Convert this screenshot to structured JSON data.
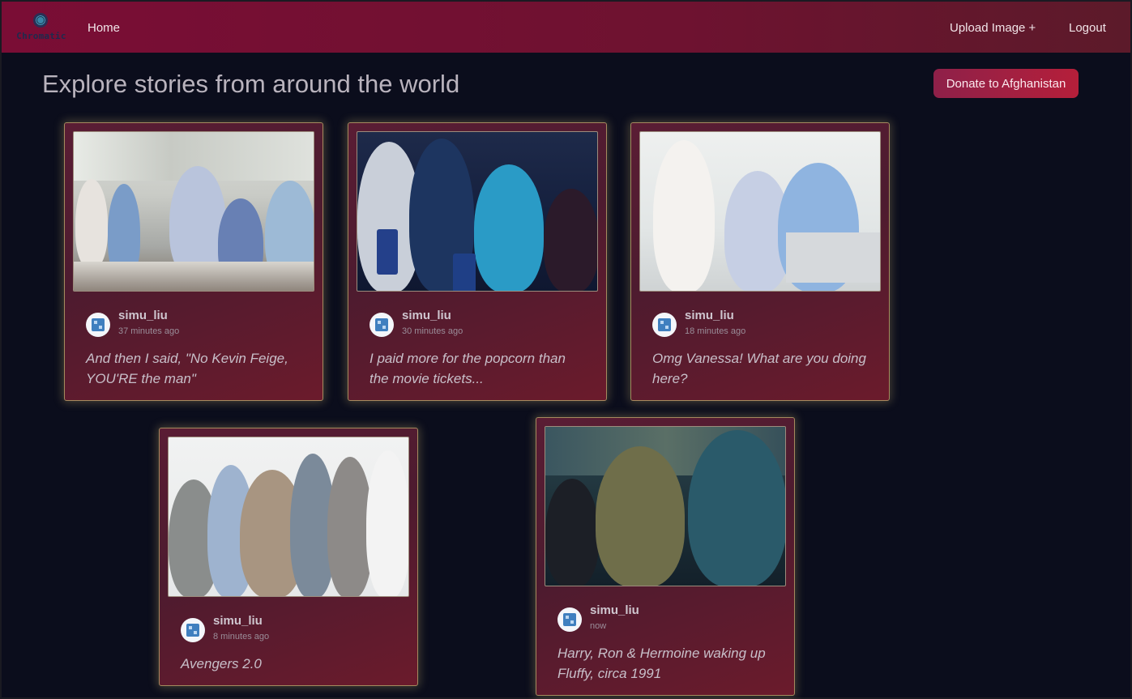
{
  "navbar": {
    "logo_text": "Chromatic",
    "home": "Home",
    "upload": "Upload Image +",
    "logout": "Logout"
  },
  "page": {
    "title": "Explore stories from around the world",
    "donate_label": "Donate to Afghanistan"
  },
  "posts": [
    {
      "username": "simu_liu",
      "time": "37 minutes ago",
      "caption": "And then I said, \"No Kevin Feige, YOU'RE the man\""
    },
    {
      "username": "simu_liu",
      "time": "30 minutes ago",
      "caption": "I paid more for the popcorn than the movie tickets..."
    },
    {
      "username": "simu_liu",
      "time": "18 minutes ago",
      "caption": "Omg Vanessa! What are you doing here?"
    },
    {
      "username": "simu_liu",
      "time": "8 minutes ago",
      "caption": "Avengers 2.0"
    },
    {
      "username": "simu_liu",
      "time": "now",
      "caption": "Harry, Ron & Hermoine waking up Fluffy, circa 1991"
    }
  ],
  "colors": {
    "background": "#0b0d1c",
    "navbar": "#7a0d35",
    "card_border": "#a58a5e",
    "donate": "#b51f3a"
  },
  "icons": {
    "logo": "chromatic-logo-icon",
    "avatar": "default-avatar-icon"
  }
}
